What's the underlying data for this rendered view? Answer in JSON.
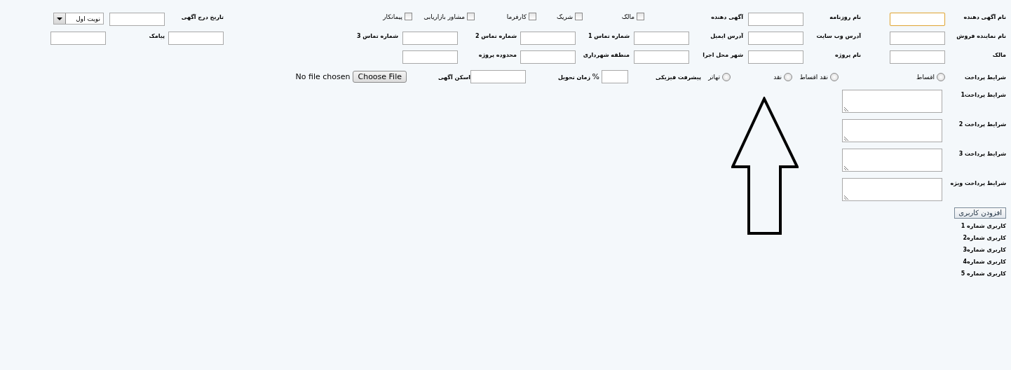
{
  "form_rows": [
    [
      {
        "kind": "label",
        "text": "نام آگهی دهنده"
      },
      {
        "kind": "input",
        "focused": true
      },
      {
        "kind": "label",
        "text": "نام روزنامه"
      },
      {
        "kind": "input",
        "focused": false
      },
      {
        "kind": "label",
        "text": "آگهی دهنده"
      },
      {
        "kind": "checkbox_group",
        "items": [
          {
            "label": "مالک",
            "checked": false
          },
          {
            "label": "شریک",
            "checked": false
          },
          {
            "label": "کارفرما",
            "checked": false
          },
          {
            "label": "مشاور بازاریابی",
            "checked": false
          },
          {
            "label": "پیمانکار",
            "checked": false
          }
        ]
      },
      {
        "kind": "label",
        "text": "تاریخ درج آگهی"
      },
      {
        "kind": "input",
        "focused": false
      },
      {
        "kind": "select",
        "value": "نوبت اول"
      }
    ],
    [
      {
        "kind": "label",
        "text": "نام نماینده فروش"
      },
      {
        "kind": "input",
        "focused": false
      },
      {
        "kind": "label",
        "text": "آدرس وب سایت"
      },
      {
        "kind": "input",
        "focused": false
      },
      {
        "kind": "label",
        "text": "آدرس ایمیل"
      },
      {
        "kind": "input",
        "focused": false
      },
      {
        "kind": "label",
        "text": "شماره تماس 1"
      },
      {
        "kind": "input",
        "focused": false
      },
      {
        "kind": "label",
        "text": "شماره تماس 2"
      },
      {
        "kind": "input",
        "focused": false
      },
      {
        "kind": "label",
        "text": "شماره تماس 3"
      },
      {
        "kind": "input",
        "focused": false
      },
      {
        "kind": "label",
        "text": "پیامک"
      },
      {
        "kind": "input",
        "focused": false
      }
    ],
    [
      {
        "kind": "label",
        "text": "مالک"
      },
      {
        "kind": "input",
        "focused": false
      },
      {
        "kind": "label",
        "text": "نام پروژه"
      },
      {
        "kind": "input",
        "focused": false
      },
      {
        "kind": "label",
        "text": "شهر محل اجرا"
      },
      {
        "kind": "input",
        "focused": false
      },
      {
        "kind": "label",
        "text": "منطقه شهرداری"
      },
      {
        "kind": "input",
        "focused": false
      },
      {
        "kind": "label",
        "text": "محدوده پروژه"
      },
      {
        "kind": "input",
        "focused": false
      }
    ]
  ],
  "payment_row": [
    {
      "kind": "label",
      "text": "شرایط پرداخت"
    },
    {
      "kind": "radio",
      "label": "اقساط",
      "selected": false
    },
    {
      "kind": "radio",
      "label": "نقد اقساط",
      "selected": false
    },
    {
      "kind": "radio",
      "label": "نقد",
      "selected": false
    },
    {
      "kind": "radio",
      "label": "تهاتر",
      "selected": false
    },
    {
      "kind": "label",
      "text": "پیشرفت فیزیکی"
    },
    {
      "kind": "input",
      "focused": false,
      "unit": "%"
    },
    {
      "kind": "label",
      "text": "زمان تحویل"
    },
    {
      "kind": "input",
      "focused": false
    },
    {
      "kind": "label",
      "text": "اسکن آگهی"
    },
    {
      "kind": "file",
      "button": "Choose File",
      "status": "No file chosen"
    }
  ],
  "payment_terms": [
    {
      "label": "شرایط پرداخت1"
    },
    {
      "label": "شرایط پرداخت 2"
    },
    {
      "label": "شرایط پرداخت 3"
    },
    {
      "label": "شرایط پرداخت ویژه"
    }
  ],
  "add_user_button": "افزودن کاربری",
  "users": [
    "کاربری شماره 1",
    "کاربری شماره2",
    "کاربری شماره3",
    "کاربری شماره4",
    "کاربری شماره 5"
  ]
}
